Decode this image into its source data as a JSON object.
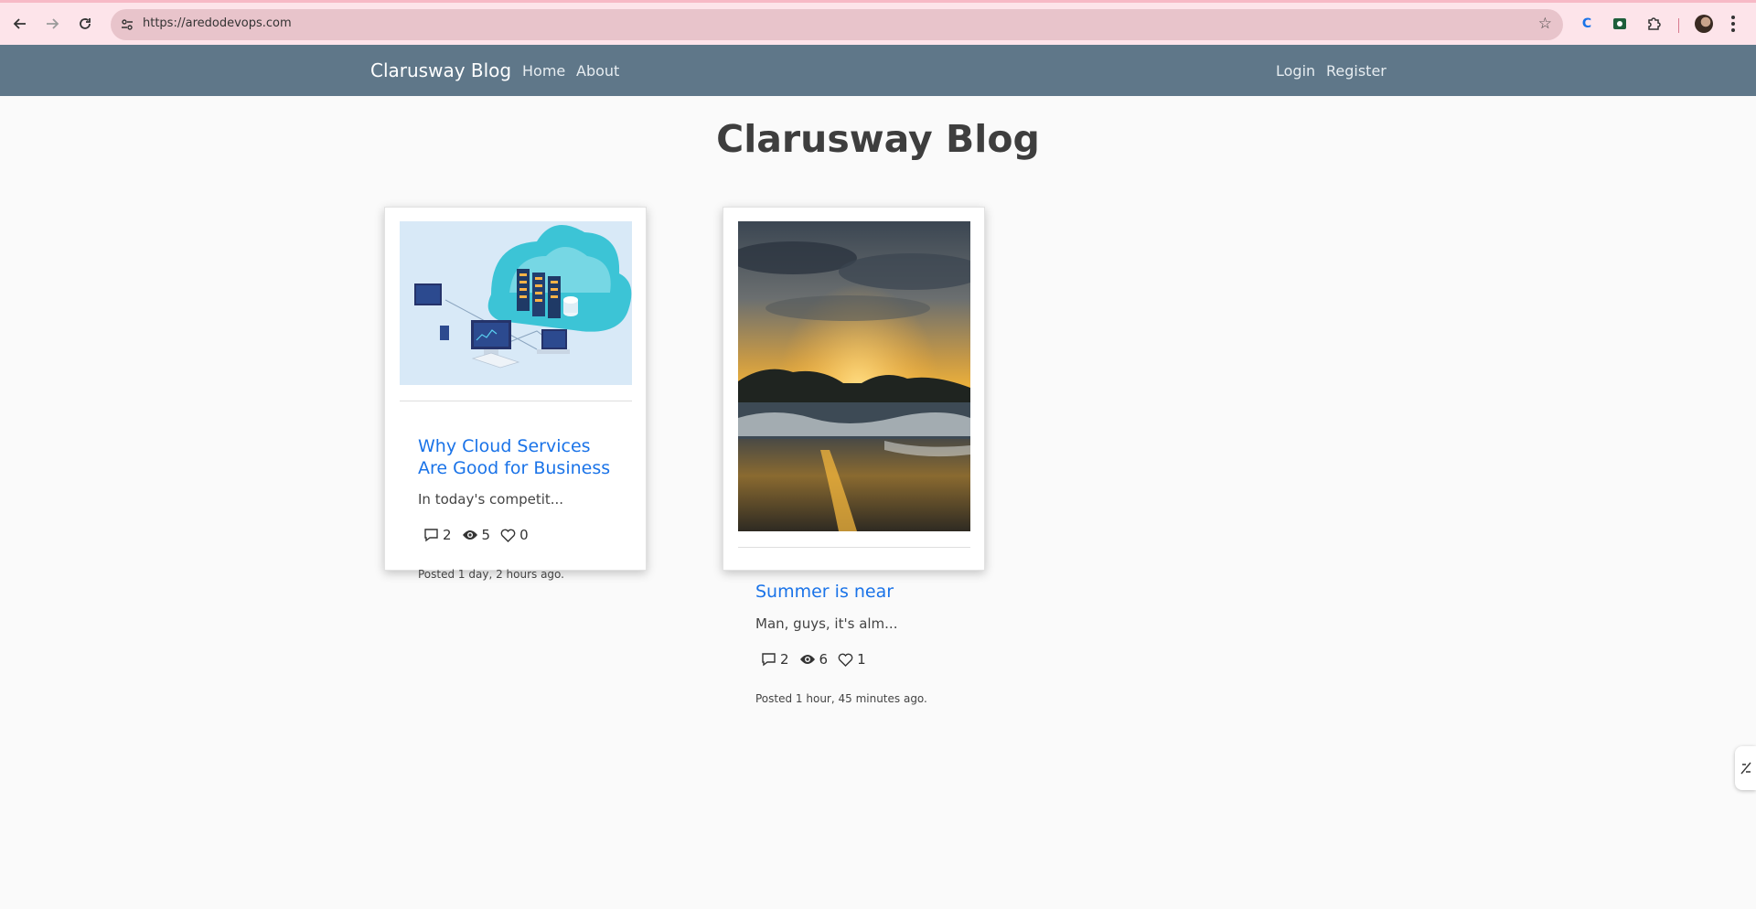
{
  "browser": {
    "url": "https://aredodevops.com"
  },
  "navbar": {
    "brand": "Clarusway Blog",
    "links": [
      "Home",
      "About"
    ],
    "auth_links": [
      "Login",
      "Register"
    ]
  },
  "page": {
    "title": "Clarusway Blog"
  },
  "posts": [
    {
      "title_line1": "Why Cloud Services",
      "title_line2": "Are Good for Business",
      "excerpt": "In today's competit...",
      "comments": "2",
      "views": "5",
      "likes": "0",
      "posted": "Posted 1 day, 2 hours ago."
    },
    {
      "title_line1": "Summer is near",
      "excerpt": "Man, guys, it's alm...",
      "comments": "2",
      "views": "6",
      "likes": "1",
      "posted": "Posted 1 hour, 45 minutes ago."
    }
  ],
  "colors": {
    "navbar": "#5f7789",
    "link": "#1a73e8",
    "chrome": "#fde4ea"
  }
}
